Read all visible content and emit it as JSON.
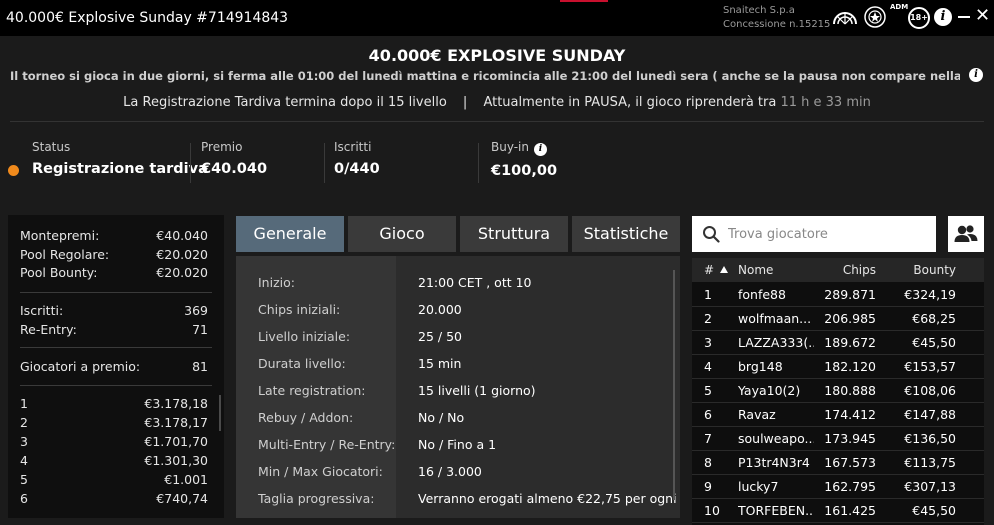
{
  "window": {
    "title": "40.000€ Explosive Sunday #714914843",
    "brand_line1": "Snaitech S.p.a",
    "brand_line2": "Concessione n.15215",
    "adm_text": "ADM",
    "age_badge": "18+",
    "info_icon_glyph": "i",
    "close_glyph": "✕",
    "icons": {
      "adm": "adm-logo-icon",
      "seal": "state-seal-icon",
      "info": "info-icon",
      "minimize": "minimize-icon",
      "close": "close-icon"
    }
  },
  "header": {
    "title": "40.000€ EXPLOSIVE SUNDAY",
    "description": "Il torneo si gioca in due giorni, si ferma alle 01:00 del lunedì mattina e ricomincia alle 21:00 del lunedì sera ( anche se la pausa non compare nella lobby)....",
    "late_reg_text": "La Registrazione Tardiva termina dopo il 15 livello",
    "separator": "|",
    "pause_text": "Attualmente in PAUSA, il gioco riprenderà tra",
    "pause_time": "11 h e 33 min"
  },
  "stats": {
    "status_label": "Status",
    "status_value": "Registrazione tardiva",
    "status_color": "#f08a1c",
    "premio_label": "Premio",
    "premio_value": "€40.040",
    "iscritti_label": "Iscritti",
    "iscritti_value": "0/440",
    "buyin_label": "Buy-in",
    "buyin_value": "€100,00"
  },
  "prize_panel": {
    "montepremi_label": "Montepremi:",
    "montepremi_value": "€40.040",
    "pool_regolare_label": "Pool Regolare:",
    "pool_regolare_value": "€20.020",
    "pool_bounty_label": "Pool Bounty:",
    "pool_bounty_value": "€20.020",
    "iscritti_label": "Iscritti:",
    "iscritti_value": "369",
    "reentry_label": "Re-Entry:",
    "reentry_value": "71",
    "giocatori_label": "Giocatori a premio:",
    "giocatori_value": "81",
    "places": [
      {
        "pos": "1",
        "amount": "€3.178,18"
      },
      {
        "pos": "2",
        "amount": "€3.178,17"
      },
      {
        "pos": "3",
        "amount": "€1.701,70"
      },
      {
        "pos": "4",
        "amount": "€1.301,30"
      },
      {
        "pos": "5",
        "amount": "€1.001"
      },
      {
        "pos": "6",
        "amount": "€740,74"
      }
    ]
  },
  "tabs": [
    {
      "label": "Generale",
      "active": true
    },
    {
      "label": "Gioco",
      "active": false
    },
    {
      "label": "Struttura",
      "active": false
    },
    {
      "label": "Statistiche",
      "active": false
    }
  ],
  "general": [
    {
      "key": "Inizio:",
      "value": "21:00 CET , ott 10"
    },
    {
      "key": "Chips iniziali:",
      "value": "20.000"
    },
    {
      "key": "Livello iniziale:",
      "value": "25 / 50"
    },
    {
      "key": "Durata livello:",
      "value": "15 min"
    },
    {
      "key": "Late registration:",
      "value": "15 livelli (1 giorno)"
    },
    {
      "key": "Rebuy / Addon:",
      "value": "No / No"
    },
    {
      "key": "Multi-Entry / Re-Entry:",
      "value": "No / Fino a 1"
    },
    {
      "key": "Min / Max Giocatori:",
      "value": "16 / 3.000"
    },
    {
      "key": "Taglia progressiva:",
      "value": "Verranno erogati almeno €22,75 per ogni"
    }
  ],
  "search": {
    "placeholder": "Trova giocatore"
  },
  "players_table": {
    "columns": {
      "num": "#",
      "name": "Nome",
      "chips": "Chips",
      "bounty": "Bounty"
    },
    "rows": [
      {
        "num": "1",
        "name": "fonfe88",
        "chips": "289.871",
        "bounty": "€324,19"
      },
      {
        "num": "2",
        "name": "wolfmaan...",
        "chips": "206.985",
        "bounty": "€68,25"
      },
      {
        "num": "3",
        "name": "LAZZA333(...",
        "chips": "189.672",
        "bounty": "€45,50"
      },
      {
        "num": "4",
        "name": "brg148",
        "chips": "182.120",
        "bounty": "€153,57"
      },
      {
        "num": "5",
        "name": "Yaya10(2)",
        "chips": "180.888",
        "bounty": "€108,06"
      },
      {
        "num": "6",
        "name": "Ravaz",
        "chips": "174.412",
        "bounty": "€147,88"
      },
      {
        "num": "7",
        "name": "soulweapo...",
        "chips": "173.945",
        "bounty": "€136,50"
      },
      {
        "num": "8",
        "name": "P13tr4N3r4",
        "chips": "167.573",
        "bounty": "€113,75"
      },
      {
        "num": "9",
        "name": "lucky7",
        "chips": "162.795",
        "bounty": "€307,13"
      },
      {
        "num": "10",
        "name": "TORFEBEN...",
        "chips": "161.425",
        "bounty": "€45,50"
      }
    ]
  }
}
